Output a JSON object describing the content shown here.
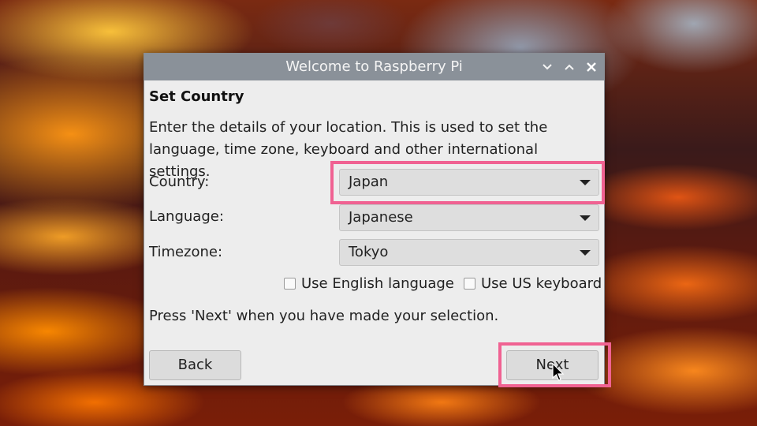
{
  "window": {
    "title": "Welcome to Raspberry Pi",
    "controls": [
      "minimize",
      "maximize",
      "close"
    ]
  },
  "page": {
    "heading": "Set Country",
    "description": "Enter the details of your location. This is used to set the language, time zone, keyboard and other international settings.",
    "note": "Press 'Next' when you have made your selection."
  },
  "fields": {
    "country": {
      "label": "Country:",
      "value": "Japan"
    },
    "language": {
      "label": "Language:",
      "value": "Japanese"
    },
    "timezone": {
      "label": "Timezone:",
      "value": "Tokyo"
    }
  },
  "options": {
    "english_language": {
      "label": "Use English language",
      "checked": false
    },
    "us_keyboard": {
      "label": "Use US keyboard",
      "checked": false
    }
  },
  "buttons": {
    "back": "Back",
    "next": "Next"
  },
  "colors": {
    "titlebar": "#8a9199",
    "dialog_background": "#ededed",
    "highlight": "#f06292"
  },
  "icons": {
    "minimize": "chevron-down-icon",
    "maximize": "chevron-up-icon",
    "close": "close-icon",
    "dropdown": "triangle-down-icon"
  }
}
